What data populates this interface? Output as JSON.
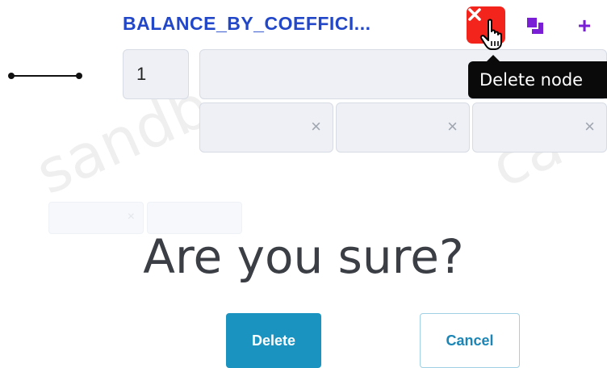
{
  "node": {
    "title": "BALANCE_BY_COEFFICI...",
    "weight_value": "1",
    "name_value": "",
    "sub_fields": [
      "",
      "",
      ""
    ],
    "clear_symbol": "×"
  },
  "toolbar": {
    "delete_node_icon": "x-icon",
    "copy_icon": "duplicate-icon",
    "add_icon": "plus-icon",
    "add_symbol": "+",
    "accent_purple": "#7a1fd6",
    "delete_red": "#f2241b"
  },
  "tooltip": {
    "text": "Delete node"
  },
  "dialog": {
    "title": "Are you sure?",
    "delete_label": "Delete",
    "cancel_label": "Cancel",
    "primary_color": "#1b93c0"
  }
}
